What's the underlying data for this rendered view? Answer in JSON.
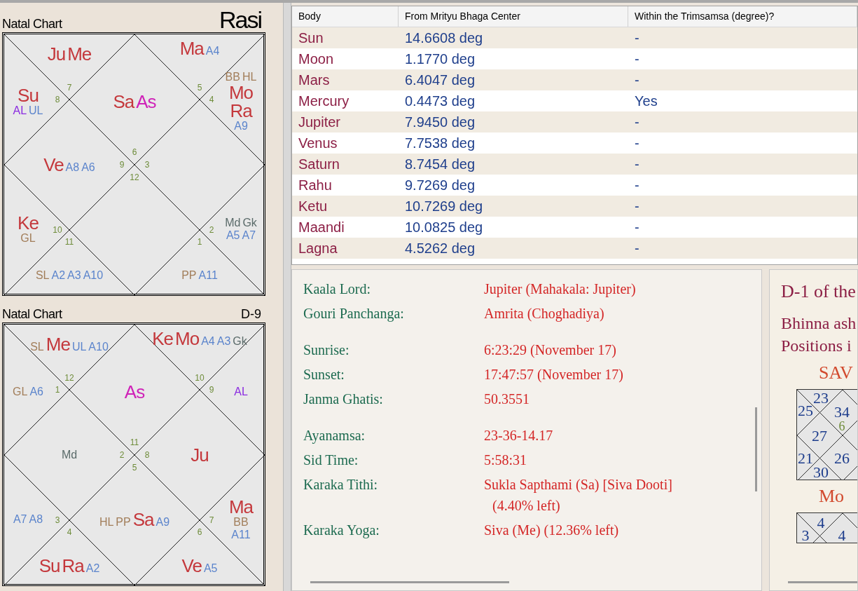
{
  "charts": [
    {
      "title": "Natal Chart",
      "label": "Rasi",
      "large_label": true,
      "houses": [
        {
          "kind": "upperleft",
          "sign": "7",
          "items": [
            {
              "text": "Ju",
              "kind": "planet"
            },
            {
              "text": "Me",
              "kind": "planet"
            }
          ]
        },
        {
          "kind": "upperright",
          "sign": "5",
          "items": [
            {
              "text": "Ma",
              "kind": "planet"
            },
            {
              "text": "A4",
              "kind": "arudha"
            }
          ]
        },
        {
          "kind": "top",
          "sign": "6",
          "items": [
            {
              "text": "Sa",
              "kind": "planet"
            },
            {
              "text": "As",
              "kind": "lagna"
            }
          ]
        },
        {
          "kind": "leftupper",
          "sign": "8",
          "items": [
            {
              "text": "Su",
              "kind": "planet"
            },
            {
              "text": "AL",
              "kind": "arudha_lagna"
            },
            {
              "text": "UL",
              "kind": "arudha"
            }
          ]
        },
        {
          "kind": "rightupper",
          "sign": "4",
          "items": [
            {
              "text": "BB",
              "kind": "special"
            },
            {
              "text": "HL",
              "kind": "special"
            },
            {
              "text": "Mo",
              "kind": "planet"
            },
            {
              "text": "Ra",
              "kind": "planet"
            },
            {
              "text": "A9",
              "kind": "arudha"
            }
          ]
        },
        {
          "kind": "left",
          "sign": "9",
          "items": [
            {
              "text": "Ve",
              "kind": "planet"
            },
            {
              "text": "A8",
              "kind": "arudha"
            },
            {
              "text": "A6",
              "kind": "arudha"
            }
          ]
        },
        {
          "kind": "right",
          "sign": "3"
        },
        {
          "kind": "leftlower",
          "sign": "10",
          "items": [
            {
              "text": "Ke",
              "kind": "planet"
            },
            {
              "text": "GL",
              "kind": "special"
            }
          ]
        },
        {
          "kind": "bottom",
          "sign": "12"
        },
        {
          "kind": "rightlower",
          "sign": "2",
          "items": [
            {
              "text": "Md",
              "kind": "upagraha"
            },
            {
              "text": "Gk",
              "kind": "upagraha"
            },
            {
              "text": "A5",
              "kind": "arudha"
            },
            {
              "text": "A7",
              "kind": "arudha"
            }
          ]
        },
        {
          "kind": "lowerleft",
          "sign": "11",
          "items": [
            {
              "text": "SL",
              "kind": "special"
            },
            {
              "text": "A2",
              "kind": "arudha"
            },
            {
              "text": "A3",
              "kind": "arudha"
            },
            {
              "text": "A10",
              "kind": "arudha"
            }
          ]
        },
        {
          "kind": "lowerright",
          "sign": "1",
          "items": [
            {
              "text": "PP",
              "kind": "special"
            },
            {
              "text": "A11",
              "kind": "arudha"
            }
          ]
        }
      ]
    },
    {
      "title": "Natal Chart",
      "label": "D-9",
      "large_label": false,
      "houses": [
        {
          "kind": "upperleft",
          "sign": "12",
          "items": [
            {
              "text": "SL",
              "kind": "special"
            },
            {
              "text": "Me",
              "kind": "planet"
            },
            {
              "text": "UL",
              "kind": "arudha"
            },
            {
              "text": "A10",
              "kind": "arudha"
            }
          ]
        },
        {
          "kind": "upperright",
          "sign": "10",
          "items": [
            {
              "text": "Ke",
              "kind": "planet"
            },
            {
              "text": "Mo",
              "kind": "planet"
            },
            {
              "text": "A4",
              "kind": "arudha"
            },
            {
              "text": "A3",
              "kind": "arudha"
            },
            {
              "text": "Gk",
              "kind": "upagraha"
            }
          ]
        },
        {
          "kind": "leftupper",
          "sign": "1",
          "items": [
            {
              "text": "GL",
              "kind": "special"
            },
            {
              "text": "A6",
              "kind": "arudha"
            }
          ]
        },
        {
          "kind": "top",
          "sign": "11",
          "items": [
            {
              "text": "As",
              "kind": "lagna"
            }
          ]
        },
        {
          "kind": "rightupper",
          "sign": "9",
          "items": [
            {
              "text": "AL",
              "kind": "arudha_lagna"
            }
          ]
        },
        {
          "kind": "left",
          "sign": "2",
          "items": [
            {
              "text": "Md",
              "kind": "upagraha"
            }
          ]
        },
        {
          "kind": "right",
          "sign": "8",
          "items": [
            {
              "text": "Ju",
              "kind": "planet"
            }
          ]
        },
        {
          "kind": "leftlower",
          "sign": "3",
          "items": [
            {
              "text": "A7",
              "kind": "arudha"
            },
            {
              "text": "A8",
              "kind": "arudha"
            }
          ]
        },
        {
          "kind": "bottom",
          "sign": "5",
          "items": [
            {
              "text": "HL",
              "kind": "special"
            },
            {
              "text": "PP",
              "kind": "special"
            },
            {
              "text": "Sa",
              "kind": "planet"
            },
            {
              "text": "A9",
              "kind": "arudha"
            }
          ]
        },
        {
          "kind": "rightlower",
          "sign": "7",
          "items": [
            {
              "text": "Ma",
              "kind": "planet"
            },
            {
              "text": "BB",
              "kind": "special"
            },
            {
              "text": "A11",
              "kind": "arudha"
            }
          ]
        },
        {
          "kind": "lowerleft",
          "sign": "4",
          "items": [
            {
              "text": "Su",
              "kind": "planet"
            },
            {
              "text": "Ra",
              "kind": "planet"
            },
            {
              "text": "A2",
              "kind": "arudha"
            }
          ]
        },
        {
          "kind": "lowerright",
          "sign": "6",
          "items": [
            {
              "text": "Ve",
              "kind": "planet"
            },
            {
              "text": "A5",
              "kind": "arudha"
            }
          ]
        }
      ]
    }
  ],
  "table": {
    "columns": [
      "Body",
      "From Mrityu Bhaga Center",
      "Within the Trimsamsa (degree)?"
    ],
    "rows": [
      [
        "Sun",
        "14.6608 deg",
        "-"
      ],
      [
        "Moon",
        "1.1770 deg",
        "-"
      ],
      [
        "Mars",
        "6.4047 deg",
        "-"
      ],
      [
        "Mercury",
        "0.4473 deg",
        "Yes"
      ],
      [
        "Jupiter",
        "7.9450 deg",
        "-"
      ],
      [
        "Venus",
        "7.7538 deg",
        "-"
      ],
      [
        "Saturn",
        "8.7454 deg",
        "-"
      ],
      [
        "Rahu",
        "9.7269 deg",
        "-"
      ],
      [
        "Ketu",
        "10.7269 deg",
        "-"
      ],
      [
        "Maandi",
        "10.0825 deg",
        "-"
      ],
      [
        "Lagna",
        "4.5262 deg",
        "-"
      ]
    ]
  },
  "details": [
    [
      {
        "label": "Kaala Lord:",
        "value": "Jupiter (Mahakala: Jupiter)"
      },
      {
        "label": "Gouri Panchanga:",
        "value": "Amrita (Choghadiya)"
      }
    ],
    [
      {
        "label": "Sunrise:",
        "value": "6:23:29 (November 17)"
      },
      {
        "label": "Sunset:",
        "value": "17:47:57 (November 17)"
      },
      {
        "label": "Janma Ghatis:",
        "value": "50.3551"
      }
    ],
    [
      {
        "label": "Ayanamsa:",
        "value": "23-36-14.17"
      },
      {
        "label": "Sid Time:",
        "value": "5:58:31"
      },
      {
        "label": "Karaka Tithi:",
        "value": "Sukla Sapthami (Sa) [Siva Dooti]",
        "value_2": "(4.40% left)"
      },
      {
        "label": "Karaka Yoga:",
        "value": "Siva (Me) (12.36% left)"
      }
    ]
  ],
  "side_panel": {
    "heading": "D-1 of the",
    "lines": [
      "Bhinna ash",
      "Positions i"
    ],
    "charts": [
      {
        "title": "SAV",
        "cells": [
          {
            "text": "23",
            "kind": "bindu"
          },
          {
            "text": "25",
            "kind": "bindu"
          },
          {
            "text": "34",
            "kind": "bindu"
          },
          {
            "text": "6",
            "kind": "sign"
          },
          {
            "text": "27",
            "kind": "bindu"
          },
          {
            "text": "21",
            "kind": "bindu"
          },
          {
            "text": "26",
            "kind": "bindu"
          },
          {
            "text": "30",
            "kind": "bindu"
          }
        ]
      },
      {
        "title": "Mo",
        "cells": [
          {
            "text": "4",
            "kind": "bindu"
          },
          {
            "text": "3",
            "kind": "bindu"
          },
          {
            "text": "4",
            "kind": "bindu"
          }
        ]
      }
    ]
  }
}
